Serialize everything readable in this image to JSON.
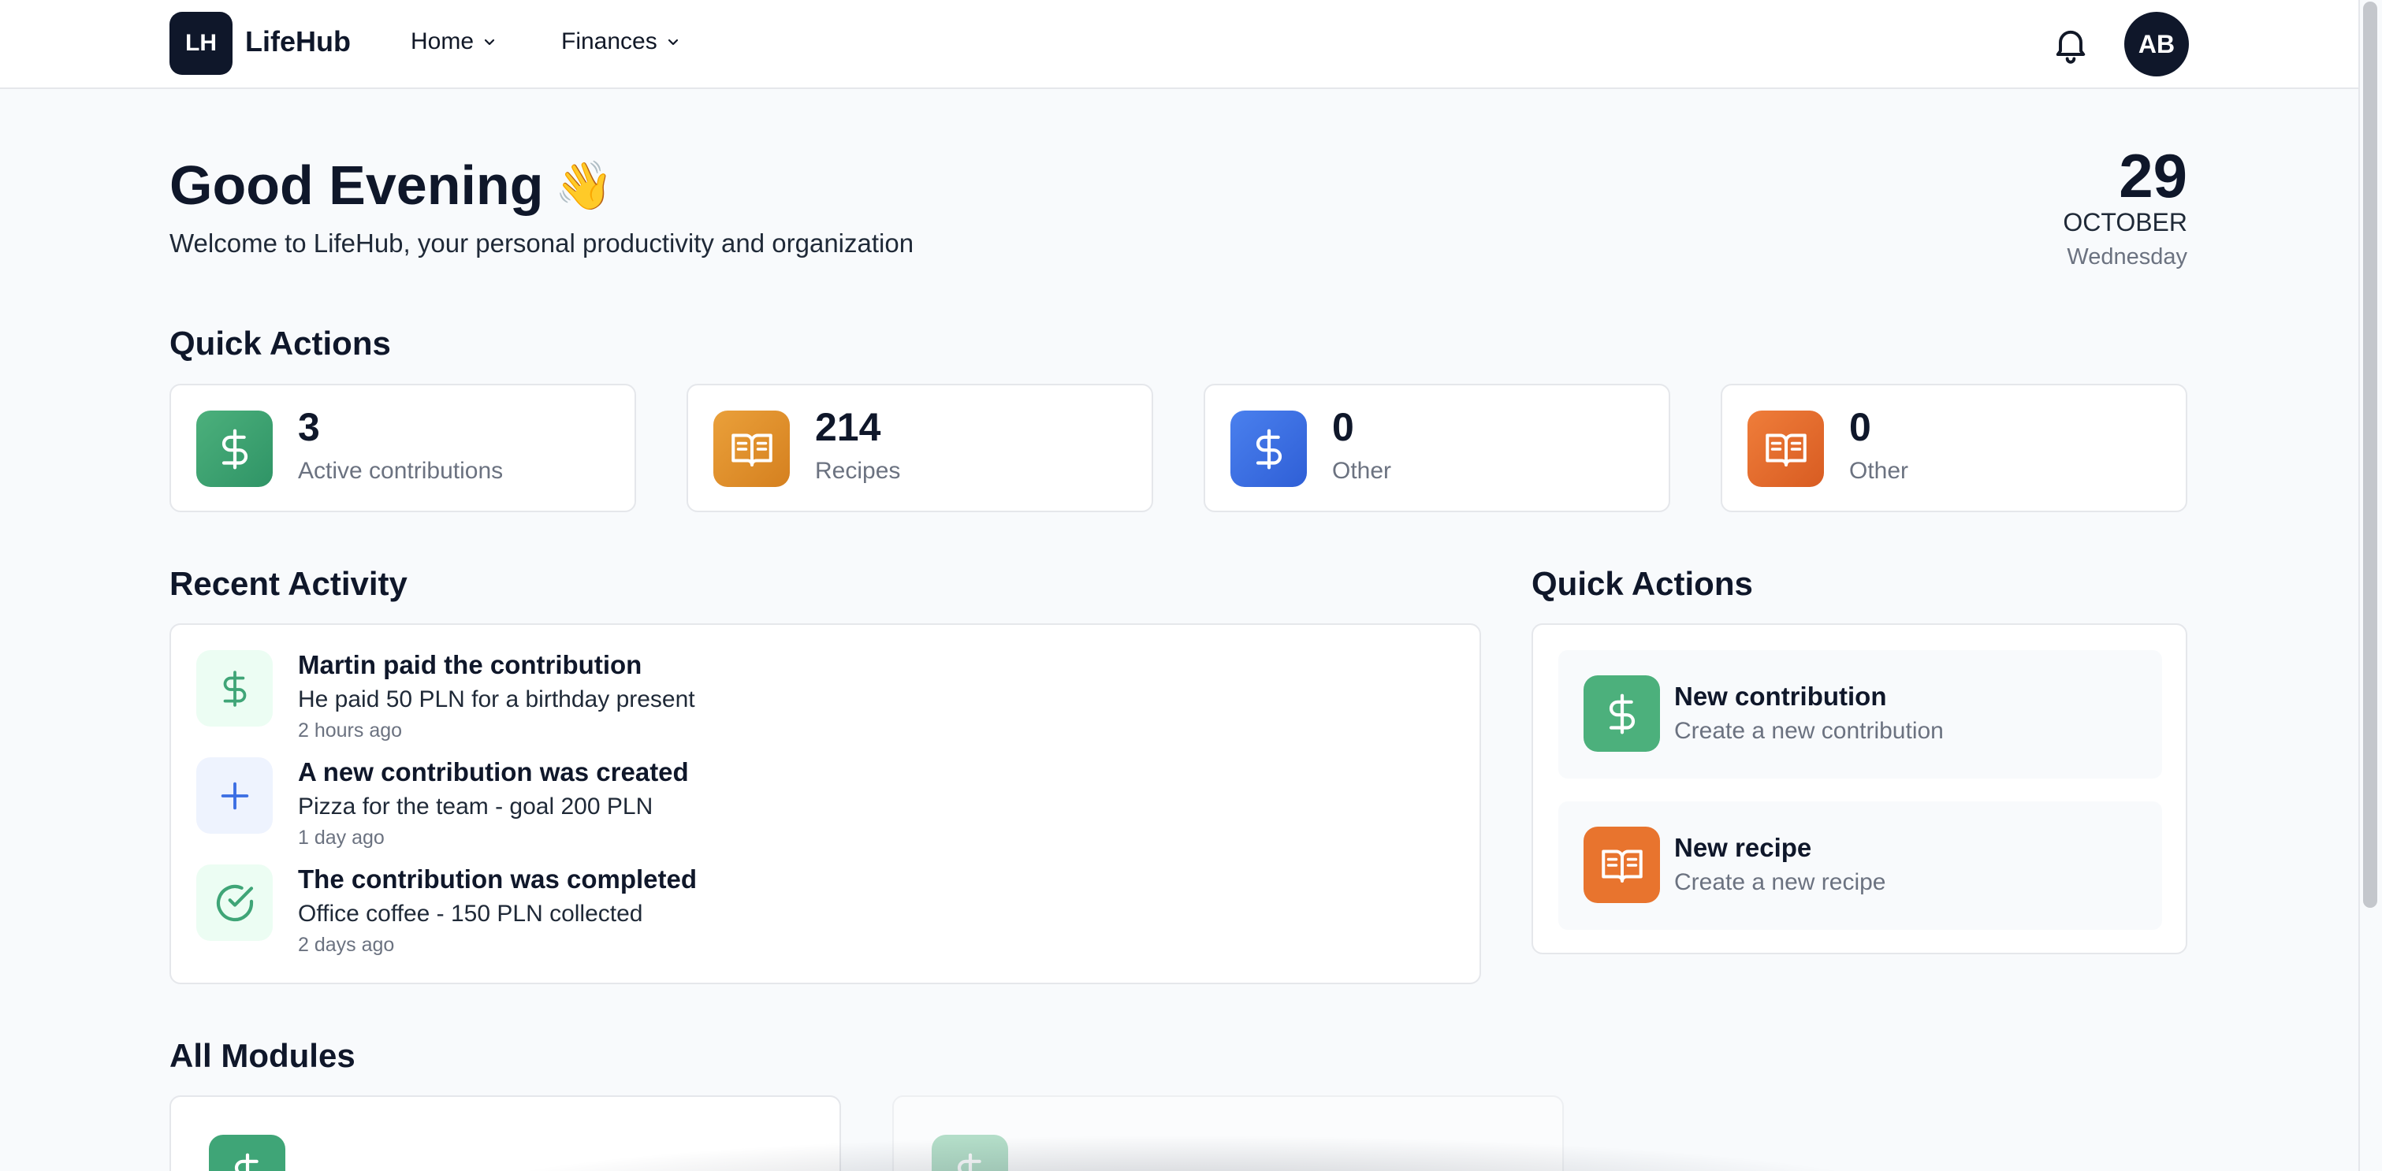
{
  "header": {
    "logo_text": "LH",
    "brand": "LifeHub",
    "nav": [
      {
        "label": "Home"
      },
      {
        "label": "Finances"
      }
    ],
    "avatar_initials": "AB"
  },
  "hero": {
    "greeting": "Good Evening",
    "greeting_emoji": "👋",
    "subtitle": "Welcome to LifeHub, your personal productivity and organization",
    "date": {
      "day": "29",
      "month": "OCTOBER",
      "weekday": "Wednesday"
    }
  },
  "stats_section": {
    "title": "Quick Actions",
    "cards": [
      {
        "value": "3",
        "label": "Active contributions",
        "icon": "dollar-icon",
        "color": "#3fa577"
      },
      {
        "value": "214",
        "label": "Recipes",
        "icon": "book-icon",
        "color": "#e08f2c"
      },
      {
        "value": "0",
        "label": "Other",
        "icon": "dollar-icon",
        "color": "#3b6ee3"
      },
      {
        "value": "0",
        "label": "Other",
        "icon": "book-icon",
        "color": "#e46b2b"
      }
    ]
  },
  "recent_activity": {
    "title": "Recent Activity",
    "items": [
      {
        "title": "Martin paid the contribution",
        "description": "He paid 50 PLN for a birthday present",
        "time": "2 hours ago",
        "icon": "dollar-icon"
      },
      {
        "title": "A new contribution was created",
        "description": "Pizza for the team - goal 200 PLN",
        "time": "1 day ago",
        "icon": "plus-icon"
      },
      {
        "title": "The contribution was completed",
        "description": "Office coffee - 150 PLN collected",
        "time": "2 days ago",
        "icon": "check-circle-icon"
      }
    ]
  },
  "quick_actions": {
    "title": "Quick Actions",
    "items": [
      {
        "title": "New contribution",
        "description": "Create a new contribution",
        "icon": "dollar-icon",
        "color": "#4cb07c"
      },
      {
        "title": "New recipe",
        "description": "Create a new recipe",
        "icon": "book-icon",
        "color": "#e8742e"
      }
    ]
  },
  "modules": {
    "title": "All Modules"
  }
}
